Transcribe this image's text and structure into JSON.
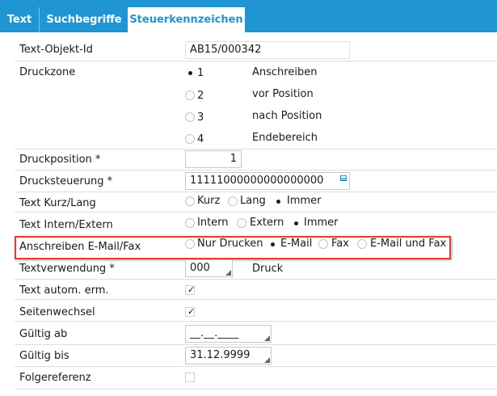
{
  "tabs": [
    {
      "label": "Text",
      "active": false
    },
    {
      "label": "Suchbegriffe",
      "active": false
    },
    {
      "label": "Steuerkennzeichen",
      "active": true
    }
  ],
  "form": {
    "text_objekt_id": {
      "label": "Text-Objekt-Id",
      "value": "AB15/000342"
    },
    "druckzone": {
      "label": "Druckzone",
      "options": [
        {
          "num": "1",
          "text": "Anschreiben",
          "selected": true
        },
        {
          "num": "2",
          "text": "vor Position",
          "selected": false
        },
        {
          "num": "3",
          "text": "nach Position",
          "selected": false
        },
        {
          "num": "4",
          "text": "Endebereich",
          "selected": false
        }
      ]
    },
    "druckposition": {
      "label": "Druckposition *",
      "value": "1"
    },
    "drucksteuerung": {
      "label": "Drucksteuerung *",
      "value": "11111000000000000000"
    },
    "text_kurz_lang": {
      "label": "Text Kurz/Lang",
      "options": [
        {
          "text": "Kurz",
          "selected": false
        },
        {
          "text": "Lang",
          "selected": false
        },
        {
          "text": "Immer",
          "selected": true
        }
      ]
    },
    "text_intern_extern": {
      "label": "Text Intern/Extern",
      "options": [
        {
          "text": "Intern",
          "selected": false
        },
        {
          "text": "Extern",
          "selected": false
        },
        {
          "text": "Immer",
          "selected": true
        }
      ]
    },
    "anschreiben": {
      "label": "Anschreiben E-Mail/Fax",
      "options": [
        {
          "text": "Nur Drucken",
          "selected": false
        },
        {
          "text": "E-Mail",
          "selected": true
        },
        {
          "text": "Fax",
          "selected": false
        },
        {
          "text": "E-Mail und Fax",
          "selected": false
        }
      ]
    },
    "textverwendung": {
      "label": "Textverwendung *",
      "value": "000",
      "description": "Druck"
    },
    "text_autom": {
      "label": "Text autom. erm.",
      "checked": true
    },
    "seitenwechsel": {
      "label": "Seitenwechsel",
      "checked": true
    },
    "gueltig_ab": {
      "label": "Gültig ab",
      "value": "__.__.____"
    },
    "gueltig_bis": {
      "label": "Gültig bis",
      "value": "31.12.9999"
    },
    "folgereferenz": {
      "label": "Folgereferenz",
      "checked": false
    }
  },
  "colors": {
    "accent": "#1f96d3",
    "highlight": "#e33b35"
  }
}
